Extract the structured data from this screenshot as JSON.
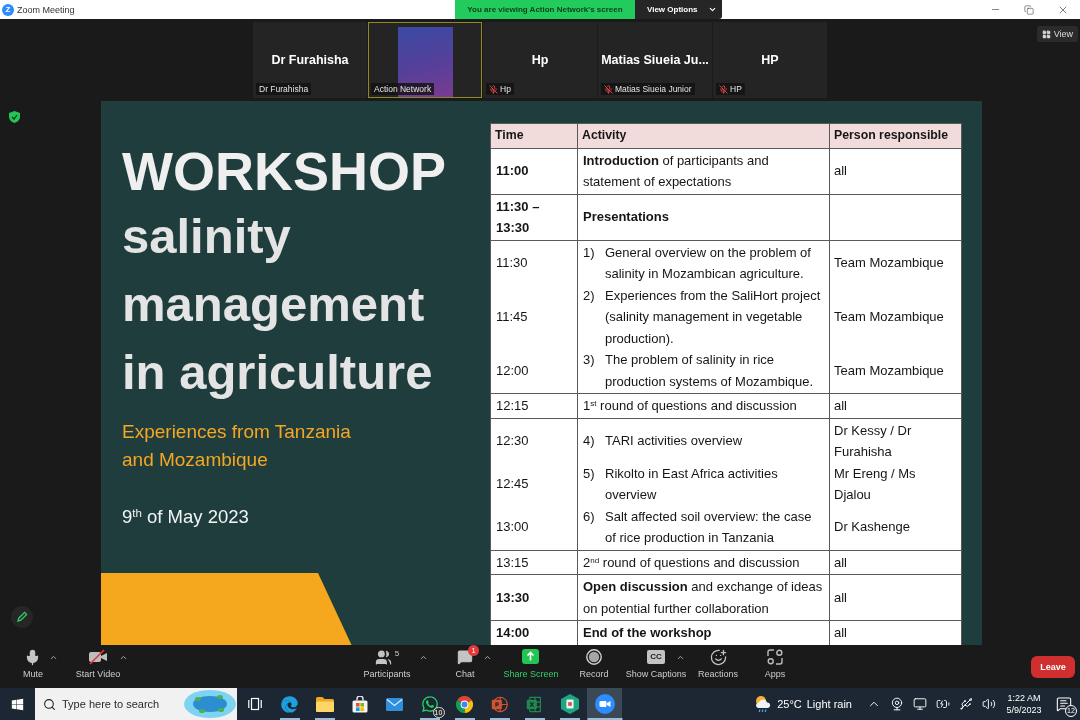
{
  "window": {
    "logo": "Z",
    "title": "Zoom Meeting"
  },
  "share_banner": {
    "text": "You are viewing Action Network's screen",
    "button": "View Options"
  },
  "participants": [
    {
      "kind": "name",
      "name": "Dr Furahisha",
      "label": "Dr Furahisha",
      "muted": false,
      "highlighted": false
    },
    {
      "kind": "video",
      "label": "Action Network",
      "muted": false,
      "highlighted": true
    },
    {
      "kind": "name",
      "name": "Hp",
      "label": "Hp",
      "muted": true,
      "highlighted": false
    },
    {
      "kind": "name",
      "name": "Matias Siueia Ju...",
      "label": "Matias Siueia Junior",
      "muted": true,
      "highlighted": false
    },
    {
      "kind": "name",
      "name": "HP",
      "label": "HP",
      "muted": true,
      "highlighted": false
    }
  ],
  "view_button": "View",
  "slide": {
    "title": "WORKSHOP",
    "heading": "salinity management in agriculture",
    "subtitle": "Experiences from Tanzania and Mozambique",
    "date": "9$^{th}$ of May 2023",
    "table": {
      "columns": [
        "Time",
        "Activity",
        "Person responsible"
      ],
      "rows": [
        {
          "entries": [
            {
              "time": "11:00",
              "time_bold": true,
              "activity": "**Introduction** of participants and statement of expectations",
              "activity_bold": false,
              "person": "all"
            }
          ]
        },
        {
          "entries": [
            {
              "time": "11:30 – 13:30",
              "time_bold": true,
              "activity": "Presentations",
              "activity_bold": true
            }
          ]
        },
        {
          "entries": [
            {
              "time": "11:30",
              "time_bold": false,
              "number": "1)",
              "activity": "General overview on the problem of salinity in Mozambican agriculture.",
              "activity_bold": false,
              "person": "Team Mozambique"
            },
            {
              "time": "11:45",
              "time_bold": false,
              "number": "2)",
              "activity": "Experiences from the SaliHort project (salinity management in vegetable production).",
              "activity_bold": false,
              "person": "Team Mozambique"
            },
            {
              "time": "12:00",
              "time_bold": false,
              "number": "3)",
              "activity": "The problem of salinity in rice production systems of Mozambique.",
              "activity_bold": false,
              "person": "Team Mozambique"
            }
          ]
        },
        {
          "entries": [
            {
              "time": "12:15",
              "time_bold": false,
              "activity": "1$^{st}$ round of questions and discussion",
              "activity_bold": false,
              "person": "all"
            }
          ]
        },
        {
          "entries": [
            {
              "time": "12:30",
              "time_bold": false,
              "number": "4)",
              "activity": "TARI activities overview",
              "activity_bold": false,
              "person": "Dr Kessy / Dr Furahisha"
            },
            {
              "time": "12:45",
              "time_bold": false,
              "number": "5)",
              "activity": "Rikolto in East Africa activities overview",
              "activity_bold": false,
              "person": "Mr Ereng / Ms Djalou"
            },
            {
              "time": "13:00",
              "time_bold": false,
              "number": "6)",
              "activity": "Salt affected soil overview: the case of rice production in Tanzania",
              "activity_bold": false,
              "person": "Dr Kashenge"
            }
          ]
        },
        {
          "entries": [
            {
              "time": "13:15",
              "time_bold": false,
              "activity": "2$^{nd}$ round of questions and discussion",
              "activity_bold": false,
              "person": "all"
            }
          ]
        },
        {
          "entries": [
            {
              "time": "13:30",
              "time_bold": true,
              "activity": "**Open discussion** and exchange of ideas on potential further collaboration",
              "activity_bold": false,
              "person": "all"
            }
          ]
        },
        {
          "entries": [
            {
              "time": "14:00",
              "time_bold": true,
              "activity": "End of the workshop",
              "activity_bold": true,
              "person": "all"
            }
          ]
        }
      ]
    }
  },
  "toolbar": {
    "left": [
      {
        "kind": "mic",
        "label": "Mute",
        "caret": true
      },
      {
        "kind": "video",
        "label": "Start Video",
        "caret": true
      }
    ],
    "center": [
      {
        "kind": "participants",
        "label": "Participants",
        "count": "5",
        "caret": true
      },
      {
        "kind": "chat",
        "label": "Chat",
        "badge": "1",
        "caret": true
      },
      {
        "kind": "share",
        "label": "Share Screen",
        "caret": false
      },
      {
        "kind": "record",
        "label": "Record",
        "caret": false
      },
      {
        "kind": "captions",
        "label": "Show Captions",
        "icon_text": "CC",
        "caret": true
      },
      {
        "kind": "reactions",
        "label": "Reactions",
        "caret": false
      },
      {
        "kind": "apps",
        "label": "Apps",
        "caret": false
      }
    ],
    "leave": "Leave"
  },
  "taskbar": {
    "search": {
      "placeholder": "Type here to search"
    },
    "apps": [
      {
        "kind": "edge",
        "running": true,
        "selected": false
      },
      {
        "kind": "explorer",
        "running": true,
        "selected": false
      },
      {
        "kind": "store",
        "running": false,
        "selected": false
      },
      {
        "kind": "mail",
        "running": false,
        "selected": false
      },
      {
        "kind": "whatsapp",
        "badge": "10",
        "running": true,
        "selected": false
      },
      {
        "kind": "chrome",
        "running": true,
        "selected": false
      },
      {
        "kind": "powerpoint",
        "running": true,
        "selected": false
      },
      {
        "kind": "excel",
        "running": true,
        "selected": false
      },
      {
        "kind": "hexagon",
        "running": true,
        "selected": false
      },
      {
        "kind": "zoom",
        "running": true,
        "selected": true
      }
    ],
    "weather": {
      "temperature": "25°C",
      "condition": "Light rain"
    },
    "clock": {
      "time": "1:22 AM",
      "date": "5/9/2023"
    },
    "notifications": {
      "count": "12"
    }
  }
}
